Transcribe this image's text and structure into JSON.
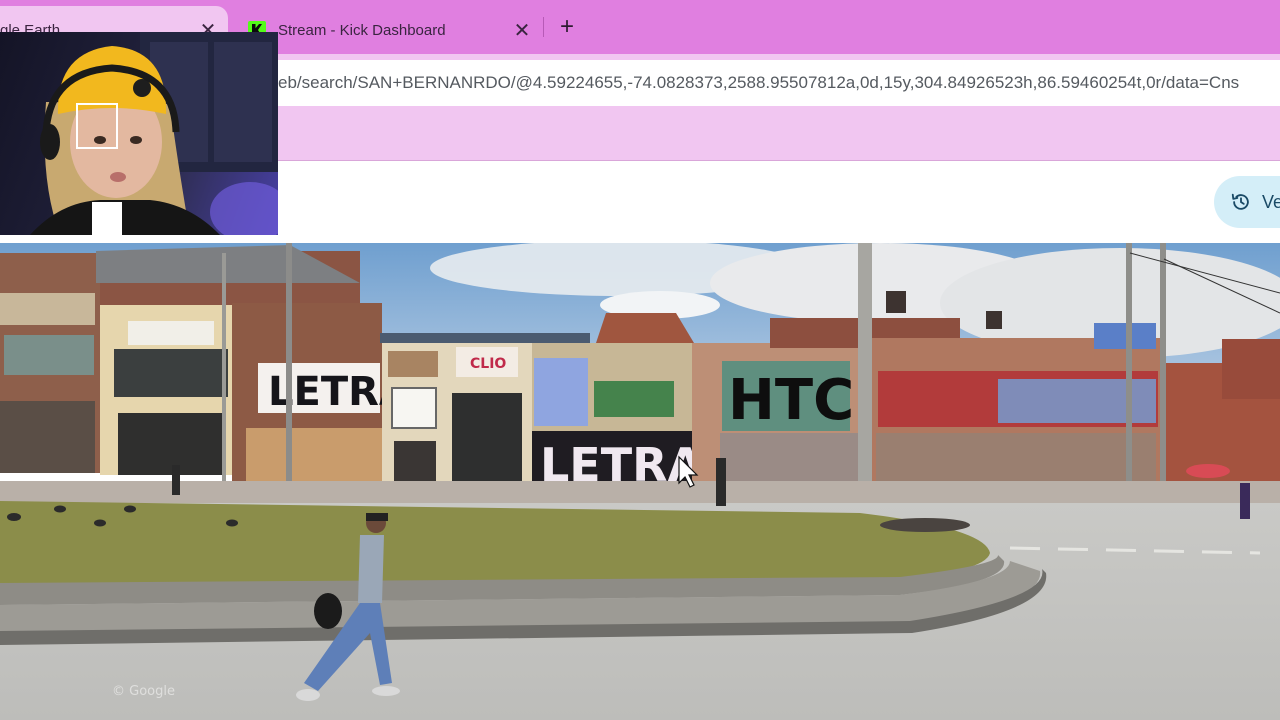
{
  "browser": {
    "tabs": [
      {
        "title": "gle Earth",
        "active": true
      },
      {
        "title": "Stream - Kick Dashboard",
        "active": false
      }
    ],
    "new_tab_symbol": "+",
    "close_symbol": "✕",
    "address_bar": {
      "url": "eb/search/SAN+BERNANRDO/@4.59224655,-74.0828373,2588.95507812a,0d,15y,304.84926523h,86.59460254t,0r/data=Cns"
    }
  },
  "page": {
    "history_chip_label": "Ve",
    "history_icon": "history-icon"
  },
  "street_view": {
    "graffiti": [
      {
        "text": "LETRA",
        "color": "#ffffff"
      },
      {
        "text": "LETRA",
        "color": "#f0e8f0"
      },
      {
        "text": "HTC",
        "color": "#0e0e0e"
      }
    ],
    "shop_signs": [
      "CLIO"
    ],
    "watermark": "© Google"
  },
  "colors": {
    "tab_strip": "#e07fe0",
    "toolbar": "#f1c6f1",
    "chip": "#d4eef8"
  }
}
